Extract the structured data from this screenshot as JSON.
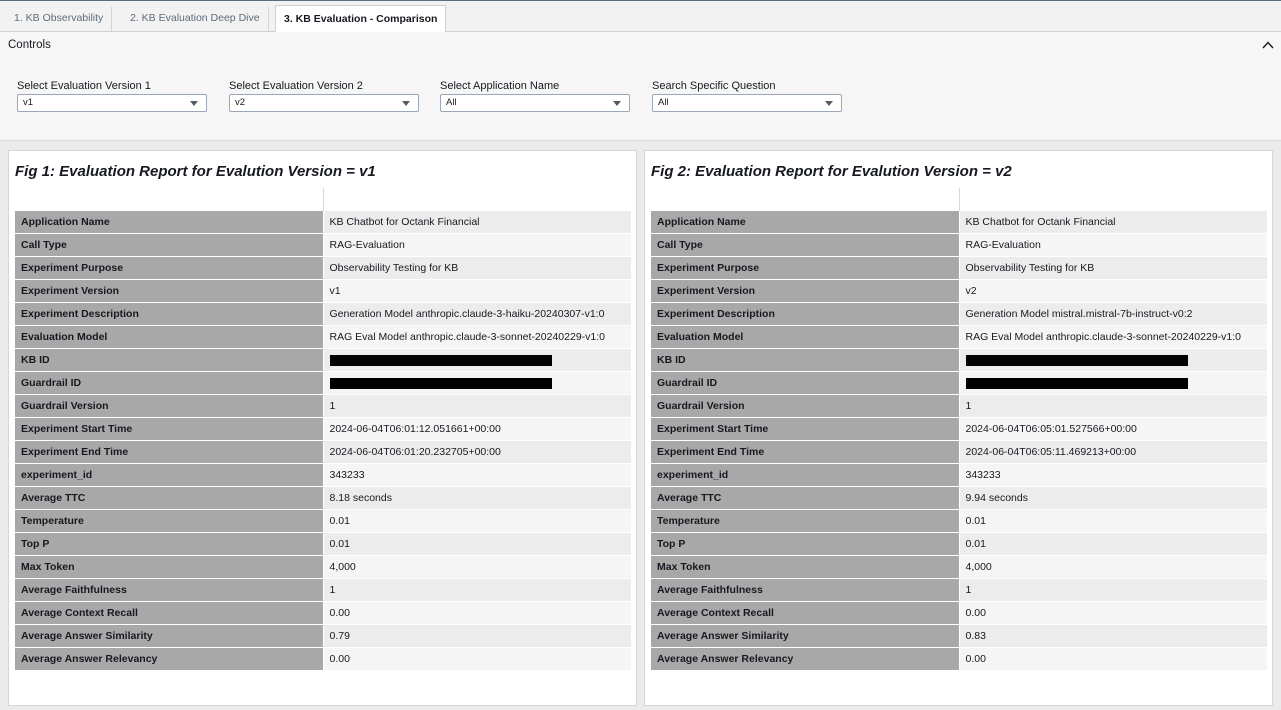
{
  "tabs": [
    {
      "label": "1. KB Observability"
    },
    {
      "label": "2. KB Evaluation Deep Dive"
    },
    {
      "label": "3. KB Evaluation - Comparison"
    }
  ],
  "controls": {
    "title": "Controls",
    "fields": [
      {
        "label": "Select Evaluation Version 1",
        "value": "v1"
      },
      {
        "label": "Select Evaluation Version 2",
        "value": "v2"
      },
      {
        "label": "Select Application Name",
        "value": "All"
      },
      {
        "label": "Search Specific Question",
        "value": "All"
      }
    ]
  },
  "panels": [
    {
      "title": "Fig 1: Evaluation Report for Evalution Version = v1",
      "rows": [
        {
          "key": "Application Name",
          "value": "KB Chatbot for Octank Financial"
        },
        {
          "key": "Call Type",
          "value": "RAG-Evaluation"
        },
        {
          "key": "Experiment Purpose",
          "value": "Observability Testing for KB"
        },
        {
          "key": "Experiment Version",
          "value": "v1"
        },
        {
          "key": "Experiment Description",
          "value": "Generation Model anthropic.claude-3-haiku-20240307-v1:0"
        },
        {
          "key": "Evaluation Model",
          "value": "RAG Eval Model anthropic.claude-3-sonnet-20240229-v1:0"
        },
        {
          "key": "KB ID",
          "value": ""
        },
        {
          "key": "Guardrail ID",
          "value": ""
        },
        {
          "key": "Guardrail Version",
          "value": "1"
        },
        {
          "key": "Experiment Start Time",
          "value": "2024-06-04T06:01:12.051661+00:00"
        },
        {
          "key": "Experiment End Time",
          "value": "2024-06-04T06:01:20.232705+00:00"
        },
        {
          "key": "experiment_id",
          "value": "343233"
        },
        {
          "key": "Average TTC",
          "value": "8.18 seconds"
        },
        {
          "key": "Temperature",
          "value": "0.01"
        },
        {
          "key": "Top P",
          "value": "0.01"
        },
        {
          "key": "Max Token",
          "value": "4,000"
        },
        {
          "key": "Average Faithfulness",
          "value": "1"
        },
        {
          "key": "Average Context Recall",
          "value": "0.00"
        },
        {
          "key": "Average Answer Similarity",
          "value": "0.79"
        },
        {
          "key": "Average Answer Relevancy",
          "value": "0.00"
        }
      ]
    },
    {
      "title": "Fig 2: Evaluation Report for Evalution Version = v2",
      "rows": [
        {
          "key": "Application Name",
          "value": "KB Chatbot for Octank Financial"
        },
        {
          "key": "Call Type",
          "value": "RAG-Evaluation"
        },
        {
          "key": "Experiment Purpose",
          "value": "Observability Testing for KB"
        },
        {
          "key": "Experiment Version",
          "value": "v2"
        },
        {
          "key": "Experiment Description",
          "value": "Generation Model mistral.mistral-7b-instruct-v0:2"
        },
        {
          "key": "Evaluation Model",
          "value": "RAG Eval Model anthropic.claude-3-sonnet-20240229-v1:0"
        },
        {
          "key": "KB ID",
          "value": ""
        },
        {
          "key": "Guardrail ID",
          "value": ""
        },
        {
          "key": "Guardrail Version",
          "value": "1"
        },
        {
          "key": "Experiment Start Time",
          "value": "2024-06-04T06:05:01.527566+00:00"
        },
        {
          "key": "Experiment End Time",
          "value": "2024-06-04T06:05:11.469213+00:00"
        },
        {
          "key": "experiment_id",
          "value": "343233"
        },
        {
          "key": "Average TTC",
          "value": "9.94 seconds"
        },
        {
          "key": "Temperature",
          "value": "0.01"
        },
        {
          "key": "Top P",
          "value": "0.01"
        },
        {
          "key": "Max Token",
          "value": "4,000"
        },
        {
          "key": "Average Faithfulness",
          "value": "1"
        },
        {
          "key": "Average Context Recall",
          "value": "0.00"
        },
        {
          "key": "Average Answer Similarity",
          "value": "0.83"
        },
        {
          "key": "Average Answer Relevancy",
          "value": "0.00"
        }
      ]
    }
  ]
}
